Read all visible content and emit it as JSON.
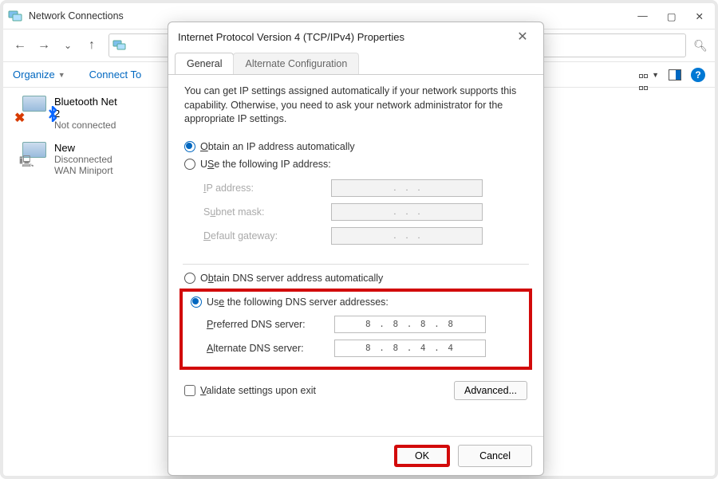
{
  "explorer": {
    "title": "Network Connections",
    "menu": {
      "organize": "Organize",
      "connect_to": "Connect To"
    },
    "connections": [
      {
        "name": "Bluetooth Net",
        "line2": "2",
        "status": "Not connected"
      },
      {
        "name": "New",
        "status": "Disconnected",
        "device": "WAN Miniport"
      }
    ]
  },
  "dialog": {
    "title": "Internet Protocol Version 4 (TCP/IPv4) Properties",
    "tabs": {
      "general": "General",
      "alt": "Alternate Configuration"
    },
    "description": "You can get IP settings assigned automatically if your network supports this capability. Otherwise, you need to ask your network administrator for the appropriate IP settings.",
    "ip": {
      "auto_label_pre": "O",
      "auto_label": "btain an IP address automatically",
      "manual_label_pre": "Use the following IP address:",
      "manual_key": "S",
      "fields": {
        "ip_label_pre": "I",
        "ip_label": "P address:",
        "mask_label_pre": "S",
        "mask_label_post": "bnet mask:",
        "mask_key": "u",
        "gw_label_pre": "D",
        "gw_label": "efault gateway:"
      }
    },
    "dns": {
      "auto_label_pre": "O",
      "auto_label_post": "tain DNS server address automatically",
      "auto_key": "b",
      "manual_label_pre": "Us",
      "manual_label_post": " the following DNS server addresses:",
      "manual_key": "e",
      "preferred_label_pre": "P",
      "preferred_label": "referred DNS server:",
      "alternate_label_pre": "A",
      "alternate_label": "lternate DNS server:",
      "preferred_value": "8 . 8 . 8 . 8",
      "alternate_value": "8 . 8 . 4 . 4"
    },
    "validate_label_pre": "V",
    "validate_label": "alidate settings upon exit",
    "advanced_label": "Advanced...",
    "ok_label": "OK",
    "cancel_label": "Cancel"
  }
}
